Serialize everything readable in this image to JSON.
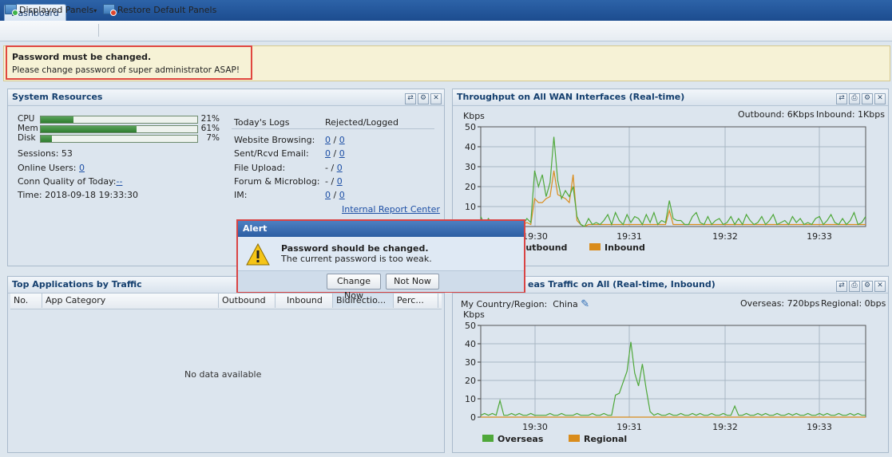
{
  "tabs": [
    {
      "label": "Dashboard"
    }
  ],
  "toolbar": {
    "displayed_panels": "Displayed Panels",
    "restore_default": "Restore Default Panels"
  },
  "banner": {
    "title": "Password must be changed.",
    "text": "Please change password of super administrator ASAP!"
  },
  "system_resources": {
    "title": "System Resources",
    "bars": [
      {
        "label": "CPU",
        "percent": 21,
        "percent_text": "21%"
      },
      {
        "label": "Mem",
        "percent": 61,
        "percent_text": "61%"
      },
      {
        "label": "Disk",
        "percent": 7,
        "percent_text": "7%"
      }
    ],
    "sessions": "Sessions: 53",
    "online_users_label": "Online Users:",
    "online_users_value": "0",
    "conn_quality_label": "Conn Quality of Today:",
    "conn_quality_value": "--",
    "time": "Time: 2018-09-18 19:33:30",
    "logs_header": "Today's Logs",
    "logs_col2": "Rejected/Logged",
    "logs": [
      {
        "name": "Website Browsing:",
        "rejected": "0",
        "logged": "0"
      },
      {
        "name": "Sent/Rcvd Email:",
        "rejected": "0",
        "logged": "0"
      },
      {
        "name": "File Upload:",
        "rejected": "-",
        "logged": "0"
      },
      {
        "name": "Forum & Microblog:",
        "rejected": "-",
        "logged": "0"
      },
      {
        "name": "IM:",
        "rejected": "0",
        "logged": "0"
      }
    ],
    "report_link": "Internal Report Center"
  },
  "throughput": {
    "title": "Throughput on All WAN Interfaces (Real-time)",
    "outbound": "Outbound: 6Kbps",
    "inbound": "Inbound: 1Kbps"
  },
  "top_apps": {
    "title": "Top Applications by Traffic",
    "columns": [
      "No.",
      "App Category",
      "Outbound",
      "Inbound",
      "Bidirectio...",
      "Perc..."
    ],
    "empty": "No data available"
  },
  "overseas": {
    "title_visible": "eas Traffic on All (Real-time, Inbound)",
    "country_label": "My Country/Region:",
    "country_value": "China",
    "overseas": "Overseas: 720bps",
    "regional": "Regional: 0bps"
  },
  "alert": {
    "title": "Alert",
    "msg_title": "Password should be changed.",
    "msg_text": "The current password is too weak.",
    "change_now": "Change Now",
    "not_now": "Not Now"
  },
  "chart_data": [
    {
      "type": "line",
      "ylabel": "Kbps",
      "ylim": [
        0,
        50
      ],
      "yticks": [
        0,
        10,
        20,
        30,
        40,
        50
      ],
      "xticks": [
        "19:30",
        "19:31",
        "19:32",
        "19:33"
      ],
      "grid": true,
      "legend": "bottom-left",
      "series": [
        {
          "name": "Outbound",
          "color": "#4fa83a",
          "values": [
            5,
            1,
            4,
            1,
            1,
            3,
            1,
            0,
            3,
            1,
            2,
            1,
            4,
            2,
            28,
            20,
            26,
            15,
            22,
            45,
            23,
            14,
            18,
            15,
            20,
            5,
            1,
            0,
            4,
            1,
            2,
            1,
            3,
            6,
            1,
            7,
            3,
            1,
            6,
            2,
            5,
            4,
            1,
            6,
            2,
            7,
            1,
            3,
            2,
            13,
            4,
            3,
            3,
            1,
            1,
            5,
            7,
            2,
            1,
            5,
            1,
            3,
            4,
            1,
            2,
            5,
            1,
            4,
            1,
            6,
            3,
            1,
            2,
            5,
            1,
            3,
            6,
            1,
            2,
            3,
            1,
            5,
            2,
            4,
            1,
            2,
            1,
            4,
            5,
            1,
            3,
            6,
            2,
            1,
            4,
            1,
            3,
            7,
            1,
            2,
            5
          ]
        },
        {
          "name": "Inbound",
          "color": "#d98c1c",
          "values": [
            1,
            1,
            1,
            1,
            1,
            1,
            1,
            0,
            1,
            1,
            1,
            1,
            2,
            1,
            14,
            12,
            12,
            14,
            15,
            28,
            16,
            15,
            14,
            12,
            26,
            3,
            1,
            0,
            1,
            1,
            1,
            1,
            1,
            1,
            1,
            1,
            1,
            1,
            1,
            1,
            1,
            1,
            1,
            1,
            1,
            1,
            1,
            1,
            1,
            8,
            1,
            1,
            1,
            1,
            1,
            1,
            1,
            1,
            1,
            1,
            1,
            1,
            1,
            1,
            1,
            1,
            1,
            1,
            1,
            1,
            1,
            1,
            1,
            1,
            1,
            1,
            1,
            1,
            1,
            1,
            1,
            1,
            1,
            1,
            1,
            1,
            1,
            1,
            1,
            1,
            1,
            1,
            1,
            1,
            1,
            1,
            1,
            1,
            1,
            1,
            1
          ]
        }
      ]
    },
    {
      "type": "line",
      "ylabel": "Kbps",
      "ylim": [
        0,
        50
      ],
      "yticks": [
        0,
        10,
        20,
        30,
        40,
        50
      ],
      "xticks": [
        "19:30",
        "19:31",
        "19:32",
        "19:33"
      ],
      "grid": true,
      "legend": "bottom-left",
      "series": [
        {
          "name": "Overseas",
          "color": "#4fa83a",
          "values": [
            1,
            2,
            1,
            2,
            1,
            9,
            1,
            1,
            2,
            1,
            2,
            1,
            1,
            2,
            1,
            1,
            1,
            1,
            2,
            1,
            1,
            2,
            1,
            1,
            1,
            2,
            1,
            1,
            1,
            2,
            1,
            1,
            2,
            1,
            1,
            12,
            13,
            19,
            25,
            41,
            24,
            17,
            29,
            15,
            3,
            1,
            2,
            1,
            1,
            2,
            1,
            1,
            2,
            1,
            1,
            2,
            1,
            2,
            1,
            1,
            2,
            1,
            1,
            2,
            1,
            1,
            6,
            1,
            1,
            2,
            1,
            1,
            2,
            1,
            2,
            1,
            1,
            2,
            1,
            1,
            2,
            1,
            2,
            1,
            1,
            2,
            1,
            1,
            2,
            1,
            2,
            1,
            1,
            2,
            1,
            1,
            2,
            1,
            2,
            1,
            1
          ]
        },
        {
          "name": "Regional",
          "color": "#d98c1c",
          "values": [
            0,
            0,
            0,
            0,
            0,
            0,
            0,
            0,
            0,
            0,
            0,
            0,
            0,
            0,
            0,
            0,
            0,
            0,
            0,
            0,
            0,
            0,
            0,
            0,
            0,
            0,
            0,
            0,
            0,
            0,
            0,
            0,
            0,
            0,
            0,
            0,
            0,
            0,
            0,
            0,
            0,
            0,
            0,
            0,
            0,
            0,
            0,
            0,
            0,
            0,
            0,
            0,
            0,
            0,
            0,
            0,
            0,
            0,
            0,
            0,
            0,
            0,
            0,
            0,
            0,
            0,
            0,
            0,
            0,
            0,
            0,
            0,
            0,
            0,
            0,
            0,
            0,
            0,
            0,
            0,
            0,
            0,
            0,
            0,
            0,
            0,
            0,
            0,
            0,
            0,
            0,
            0,
            0,
            0,
            0,
            0,
            0,
            0,
            0,
            0,
            0
          ]
        }
      ]
    }
  ]
}
